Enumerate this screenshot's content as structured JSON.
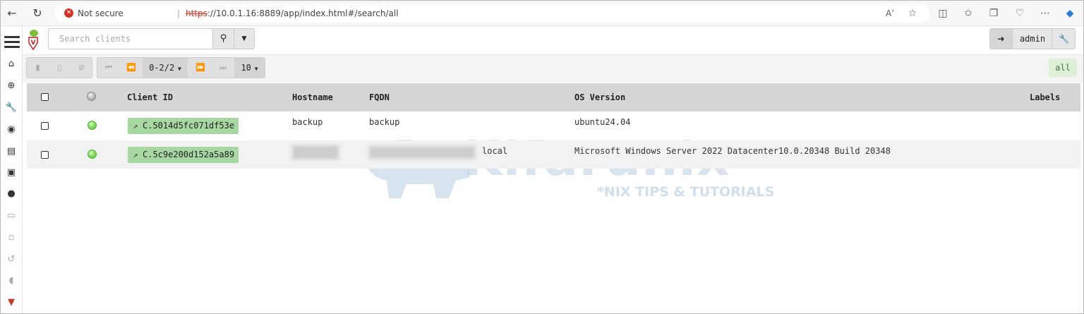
{
  "browser": {
    "security_label": "Not secure",
    "url_scheme": "https",
    "url_rest": "://10.0.1.16:8889/app/index.html#/search/all"
  },
  "search": {
    "placeholder": "Search clients"
  },
  "user": {
    "name": "admin"
  },
  "toolbar": {
    "page_range": "0-2/2",
    "page_size": "10",
    "filter_badge": "all"
  },
  "table": {
    "headers": {
      "client_id": "Client ID",
      "hostname": "Hostname",
      "fqdn": "FQDN",
      "os_version": "OS Version",
      "labels": "Labels"
    },
    "rows": [
      {
        "client_id": "C.5014d5fc071df53e",
        "hostname": "backup",
        "fqdn": "backup",
        "os_version": "ubuntu24.04",
        "labels": "",
        "status": "online"
      },
      {
        "client_id": "C.5c9e200d152a5a89",
        "hostname": "",
        "fqdn": "local",
        "os_version": "Microsoft Windows Server 2022 Datacenter10.0.20348 Build 20348",
        "labels": "",
        "status": "online"
      }
    ]
  },
  "watermark": {
    "brand": "Kifarunix",
    "tagline": "*NIX TIPS & TUTORIALS"
  },
  "colors": {
    "online": "#4fb82a",
    "client_button": "#a8d8a2",
    "badge_bg": "#dff0d8",
    "header_bg": "#d6d6d6",
    "insecure": "#d93025"
  }
}
